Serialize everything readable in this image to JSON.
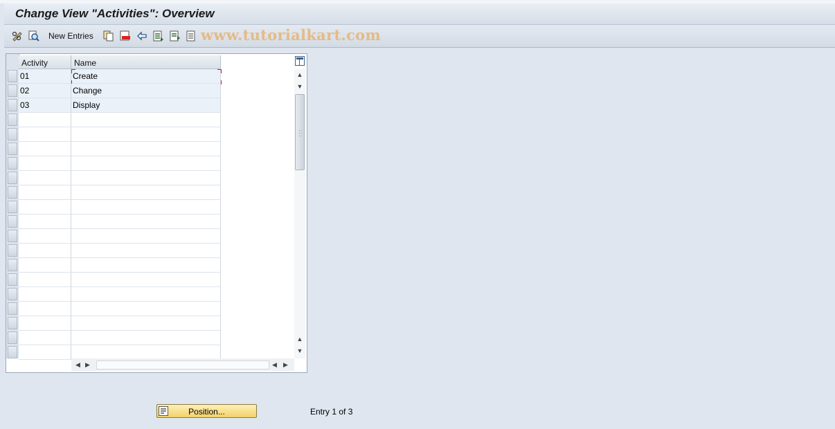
{
  "window": {
    "title": "Change View \"Activities\": Overview"
  },
  "toolbar": {
    "new_entries_label": "New Entries",
    "watermark": "www.tutorialkart.com",
    "icons": [
      "display-change-icon",
      "details-icon",
      "copy-icon",
      "delete-icon",
      "undo-icon",
      "select-all-icon",
      "select-block-icon",
      "deselect-all-icon"
    ]
  },
  "table": {
    "columns": [
      "Activity",
      "Name"
    ],
    "rows": [
      {
        "activity": "01",
        "name": "Create"
      },
      {
        "activity": "02",
        "name": "Change"
      },
      {
        "activity": "03",
        "name": "Display"
      }
    ],
    "visible_row_count": 20
  },
  "footer": {
    "position_label": "Position...",
    "entry_info": "Entry 1 of 3"
  },
  "colors": {
    "accent": "#f4d26a",
    "background": "#dfe6ef",
    "focus": "#d62020"
  }
}
